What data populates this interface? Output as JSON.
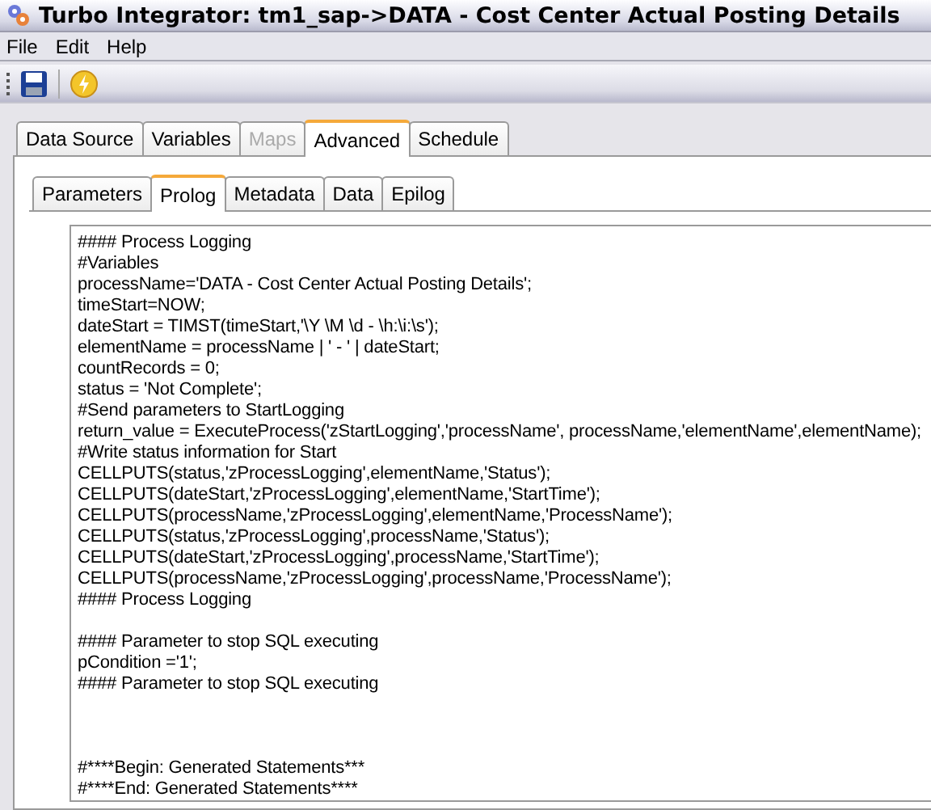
{
  "window": {
    "title": "Turbo Integrator:  tm1_sap->DATA - Cost Center Actual Posting Details"
  },
  "menu": [
    {
      "label": "File"
    },
    {
      "label": "Edit"
    },
    {
      "label": "Help"
    }
  ],
  "toolbar": [
    {
      "kind": "save"
    },
    {
      "kind": "run"
    }
  ],
  "tabs": [
    {
      "label": "Data Source",
      "selected": false,
      "disabled": false
    },
    {
      "label": "Variables",
      "selected": false,
      "disabled": false
    },
    {
      "label": "Maps",
      "selected": false,
      "disabled": true
    },
    {
      "label": "Advanced",
      "selected": true,
      "disabled": false
    },
    {
      "label": "Schedule",
      "selected": false,
      "disabled": false
    }
  ],
  "subtabs": [
    {
      "label": "Parameters",
      "selected": false
    },
    {
      "label": "Prolog",
      "selected": true
    },
    {
      "label": "Metadata",
      "selected": false
    },
    {
      "label": "Data",
      "selected": false
    },
    {
      "label": "Epilog",
      "selected": false
    }
  ],
  "editor": {
    "blocks": [
      [
        "#### Process Logging",
        "#Variables",
        "processName='DATA - Cost Center Actual Posting Details';",
        "timeStart=NOW;",
        "dateStart = TIMST(timeStart,'\\Y \\M \\d - \\h:\\i:\\s');",
        "elementName = processName | ' - ' | dateStart;",
        "countRecords = 0;",
        "status = 'Not Complete';",
        "#Send parameters to StartLogging",
        "return_value = ExecuteProcess('zStartLogging','processName', processName,'elementName',elementName);",
        "#Write status information for Start",
        "CELLPUTS(status,'zProcessLogging',elementName,'Status');",
        "CELLPUTS(dateStart,'zProcessLogging',elementName,'StartTime');",
        "CELLPUTS(processName,'zProcessLogging',elementName,'ProcessName');",
        "CELLPUTS(status,'zProcessLogging',processName,'Status');",
        "CELLPUTS(dateStart,'zProcessLogging',processName,'StartTime');",
        "CELLPUTS(processName,'zProcessLogging',processName,'ProcessName');",
        "#### Process Logging"
      ],
      [
        "#### Parameter to stop SQL executing",
        "pCondition ='1';",
        "#### Parameter to stop SQL executing"
      ],
      [
        "#****Begin: Generated Statements***",
        "#****End: Generated Statements****"
      ]
    ]
  }
}
